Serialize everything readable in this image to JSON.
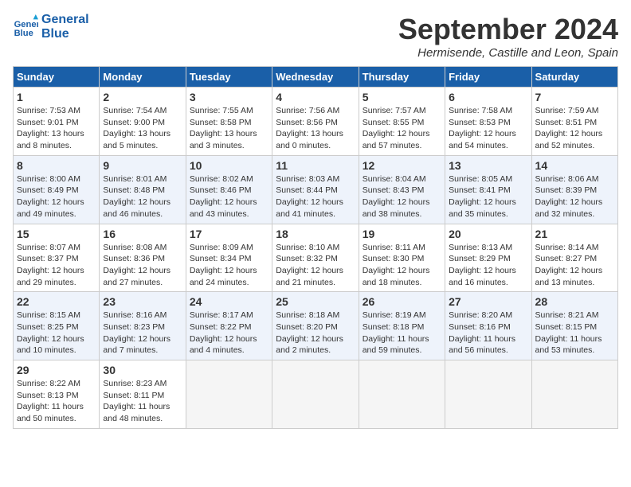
{
  "header": {
    "logo_line1": "General",
    "logo_line2": "Blue",
    "title": "September 2024",
    "subtitle": "Hermisende, Castille and Leon, Spain"
  },
  "weekdays": [
    "Sunday",
    "Monday",
    "Tuesday",
    "Wednesday",
    "Thursday",
    "Friday",
    "Saturday"
  ],
  "weeks": [
    [
      {
        "day": "1",
        "info": "Sunrise: 7:53 AM\nSunset: 9:01 PM\nDaylight: 13 hours and 8 minutes."
      },
      {
        "day": "2",
        "info": "Sunrise: 7:54 AM\nSunset: 9:00 PM\nDaylight: 13 hours and 5 minutes."
      },
      {
        "day": "3",
        "info": "Sunrise: 7:55 AM\nSunset: 8:58 PM\nDaylight: 13 hours and 3 minutes."
      },
      {
        "day": "4",
        "info": "Sunrise: 7:56 AM\nSunset: 8:56 PM\nDaylight: 13 hours and 0 minutes."
      },
      {
        "day": "5",
        "info": "Sunrise: 7:57 AM\nSunset: 8:55 PM\nDaylight: 12 hours and 57 minutes."
      },
      {
        "day": "6",
        "info": "Sunrise: 7:58 AM\nSunset: 8:53 PM\nDaylight: 12 hours and 54 minutes."
      },
      {
        "day": "7",
        "info": "Sunrise: 7:59 AM\nSunset: 8:51 PM\nDaylight: 12 hours and 52 minutes."
      }
    ],
    [
      {
        "day": "8",
        "info": "Sunrise: 8:00 AM\nSunset: 8:49 PM\nDaylight: 12 hours and 49 minutes."
      },
      {
        "day": "9",
        "info": "Sunrise: 8:01 AM\nSunset: 8:48 PM\nDaylight: 12 hours and 46 minutes."
      },
      {
        "day": "10",
        "info": "Sunrise: 8:02 AM\nSunset: 8:46 PM\nDaylight: 12 hours and 43 minutes."
      },
      {
        "day": "11",
        "info": "Sunrise: 8:03 AM\nSunset: 8:44 PM\nDaylight: 12 hours and 41 minutes."
      },
      {
        "day": "12",
        "info": "Sunrise: 8:04 AM\nSunset: 8:43 PM\nDaylight: 12 hours and 38 minutes."
      },
      {
        "day": "13",
        "info": "Sunrise: 8:05 AM\nSunset: 8:41 PM\nDaylight: 12 hours and 35 minutes."
      },
      {
        "day": "14",
        "info": "Sunrise: 8:06 AM\nSunset: 8:39 PM\nDaylight: 12 hours and 32 minutes."
      }
    ],
    [
      {
        "day": "15",
        "info": "Sunrise: 8:07 AM\nSunset: 8:37 PM\nDaylight: 12 hours and 29 minutes."
      },
      {
        "day": "16",
        "info": "Sunrise: 8:08 AM\nSunset: 8:36 PM\nDaylight: 12 hours and 27 minutes."
      },
      {
        "day": "17",
        "info": "Sunrise: 8:09 AM\nSunset: 8:34 PM\nDaylight: 12 hours and 24 minutes."
      },
      {
        "day": "18",
        "info": "Sunrise: 8:10 AM\nSunset: 8:32 PM\nDaylight: 12 hours and 21 minutes."
      },
      {
        "day": "19",
        "info": "Sunrise: 8:11 AM\nSunset: 8:30 PM\nDaylight: 12 hours and 18 minutes."
      },
      {
        "day": "20",
        "info": "Sunrise: 8:13 AM\nSunset: 8:29 PM\nDaylight: 12 hours and 16 minutes."
      },
      {
        "day": "21",
        "info": "Sunrise: 8:14 AM\nSunset: 8:27 PM\nDaylight: 12 hours and 13 minutes."
      }
    ],
    [
      {
        "day": "22",
        "info": "Sunrise: 8:15 AM\nSunset: 8:25 PM\nDaylight: 12 hours and 10 minutes."
      },
      {
        "day": "23",
        "info": "Sunrise: 8:16 AM\nSunset: 8:23 PM\nDaylight: 12 hours and 7 minutes."
      },
      {
        "day": "24",
        "info": "Sunrise: 8:17 AM\nSunset: 8:22 PM\nDaylight: 12 hours and 4 minutes."
      },
      {
        "day": "25",
        "info": "Sunrise: 8:18 AM\nSunset: 8:20 PM\nDaylight: 12 hours and 2 minutes."
      },
      {
        "day": "26",
        "info": "Sunrise: 8:19 AM\nSunset: 8:18 PM\nDaylight: 11 hours and 59 minutes."
      },
      {
        "day": "27",
        "info": "Sunrise: 8:20 AM\nSunset: 8:16 PM\nDaylight: 11 hours and 56 minutes."
      },
      {
        "day": "28",
        "info": "Sunrise: 8:21 AM\nSunset: 8:15 PM\nDaylight: 11 hours and 53 minutes."
      }
    ],
    [
      {
        "day": "29",
        "info": "Sunrise: 8:22 AM\nSunset: 8:13 PM\nDaylight: 11 hours and 50 minutes."
      },
      {
        "day": "30",
        "info": "Sunrise: 8:23 AM\nSunset: 8:11 PM\nDaylight: 11 hours and 48 minutes."
      },
      null,
      null,
      null,
      null,
      null
    ]
  ]
}
